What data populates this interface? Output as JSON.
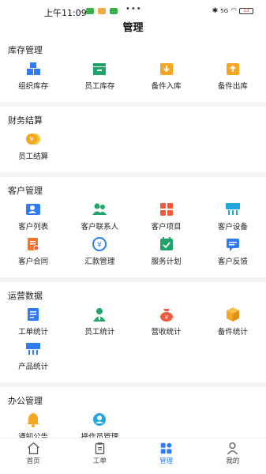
{
  "status_bar": {
    "time": "上午11:09",
    "dots": "•••",
    "signal_text": "5G",
    "battery": "13"
  },
  "header": {
    "title": "管理"
  },
  "sections": [
    {
      "title": "库存管理",
      "items": [
        {
          "label": "组织库存",
          "icon": "stacked-boxes-icon"
        },
        {
          "label": "员工库存",
          "icon": "inbox-tray-icon"
        },
        {
          "label": "备件入库",
          "icon": "box-in-icon"
        },
        {
          "label": "备件出库",
          "icon": "box-out-icon"
        }
      ]
    },
    {
      "title": "财务结算",
      "items": [
        {
          "label": "员工结算",
          "icon": "yen-coins-icon"
        }
      ]
    },
    {
      "title": "客户管理",
      "items": [
        {
          "label": "客户列表",
          "icon": "customer-card-icon"
        },
        {
          "label": "客户联系人",
          "icon": "contacts-icon"
        },
        {
          "label": "客户项目",
          "icon": "project-grid-icon"
        },
        {
          "label": "客户设备",
          "icon": "device-icon"
        },
        {
          "label": "客户合同",
          "icon": "contract-icon"
        },
        {
          "label": "汇款管理",
          "icon": "remittance-icon"
        },
        {
          "label": "服务计划",
          "icon": "plan-icon"
        },
        {
          "label": "客户反馈",
          "icon": "feedback-icon"
        }
      ]
    },
    {
      "title": "运营数据",
      "items": [
        {
          "label": "工单统计",
          "icon": "workorder-stats-icon"
        },
        {
          "label": "员工统计",
          "icon": "employee-stats-icon"
        },
        {
          "label": "营收统计",
          "icon": "revenue-bag-icon"
        },
        {
          "label": "备件统计",
          "icon": "parts-cube-icon"
        },
        {
          "label": "产品统计",
          "icon": "product-stats-icon"
        }
      ]
    },
    {
      "title": "办公管理",
      "items": [
        {
          "label": "通知公告",
          "icon": "bell-icon"
        },
        {
          "label": "操作员管理",
          "icon": "operator-icon"
        }
      ]
    }
  ],
  "tabs": [
    {
      "label": "首页",
      "icon": "home-icon",
      "active": false
    },
    {
      "label": "工单",
      "icon": "clipboard-icon",
      "active": false
    },
    {
      "label": "管理",
      "icon": "manage-icon",
      "active": true
    },
    {
      "label": "我的",
      "icon": "person-icon",
      "active": false
    }
  ],
  "colors": {
    "blue": "#2f7cf6",
    "green": "#1fa56a",
    "orange": "#f5a623",
    "red": "#f35a3d",
    "cyan": "#22a6e0"
  }
}
